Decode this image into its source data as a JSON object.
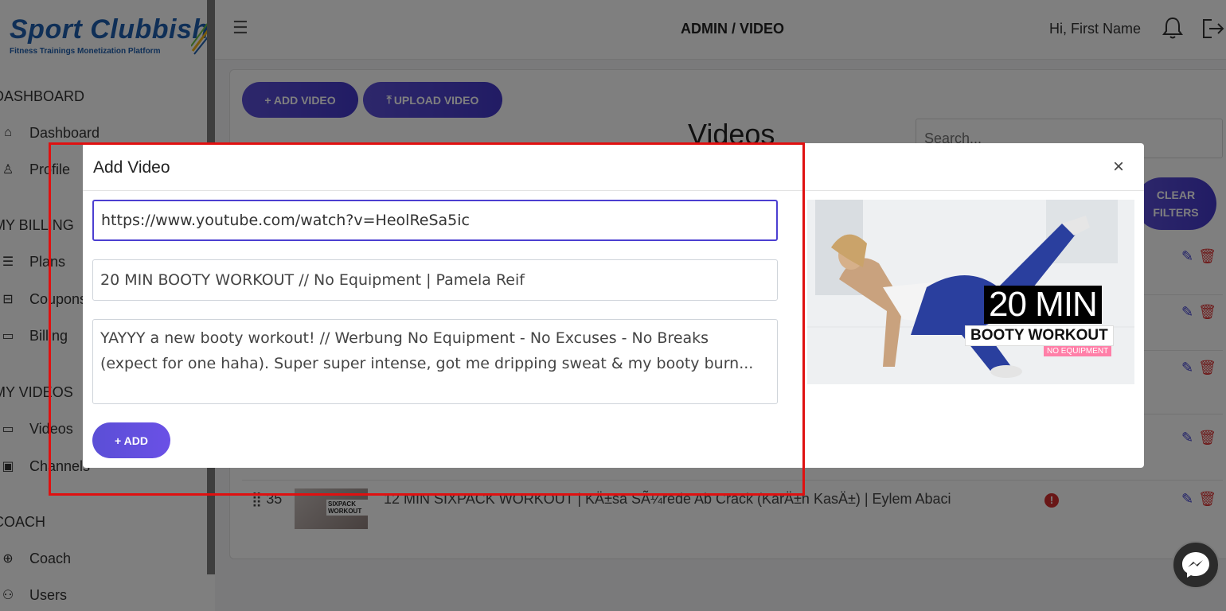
{
  "brand": {
    "name": "Sport Clubbish",
    "tagline": "Fitness Trainings Monetization Platform"
  },
  "sidebar": {
    "sections": [
      {
        "label": "DASHBOARD",
        "items": [
          {
            "label": "Dashboard",
            "icon": "home-icon"
          },
          {
            "label": "Profile",
            "icon": "user-icon"
          }
        ]
      },
      {
        "label": "MY BILLING",
        "items": [
          {
            "label": "Plans",
            "icon": "list-icon"
          },
          {
            "label": "Coupons",
            "icon": "coupon-icon"
          },
          {
            "label": "Billing",
            "icon": "card-icon"
          }
        ]
      },
      {
        "label": "MY VIDEOS",
        "items": [
          {
            "label": "Videos",
            "icon": "video-icon"
          },
          {
            "label": "Channels",
            "icon": "channel-icon"
          }
        ]
      },
      {
        "label": "COACH",
        "items": [
          {
            "label": "Coach",
            "icon": "globe-icon"
          },
          {
            "label": "Users",
            "icon": "users-icon"
          }
        ]
      }
    ]
  },
  "header": {
    "menu_icon": "hamburger-icon",
    "title": "ADMIN / VIDEO",
    "greeting": "Hi, First Name",
    "bell_icon": "bell-icon",
    "logout_icon": "logout-icon"
  },
  "main": {
    "add_video_label": "+ ADD VIDEO",
    "upload_video_label": "UPLOAD VIDEO",
    "title": "Videos",
    "search_placeholder": "Search...",
    "clear_filters_label": "CLEAR FILTERS",
    "rows": [
      {
        "id": "35",
        "title": "12 MIN SIXPACK WORKOUT | KÄ±sa SÃ¼rede Ab Crack (KarÄ±n KasÄ±) | Eylem Abaci",
        "thumb_text": "SIXPACK WORKOUT",
        "status": "!"
      }
    ]
  },
  "modal": {
    "title": "Add Video",
    "close_label": "×",
    "url_value": "https://www.youtube.com/watch?v=HeolReSa5ic",
    "title_value": "20 MIN BOOTY WORKOUT // No Equipment | Pamela Reif",
    "description_value": "YAYYY a new booty workout! // Werbung No Equipment - No Excuses - No Breaks (expect for one haha). Super super intense, got me dripping sweat & my booty burn...",
    "add_label": "+ ADD",
    "preview": {
      "big_text": "20 MIN",
      "sub_text": "BOOTY WORKOUT",
      "tag_text": "NO EQUIPMENT"
    }
  },
  "colors": {
    "accent": "#4c3fd1",
    "brand": "#1f5fae",
    "highlight": "#e01010",
    "delete": "#dd3333"
  }
}
